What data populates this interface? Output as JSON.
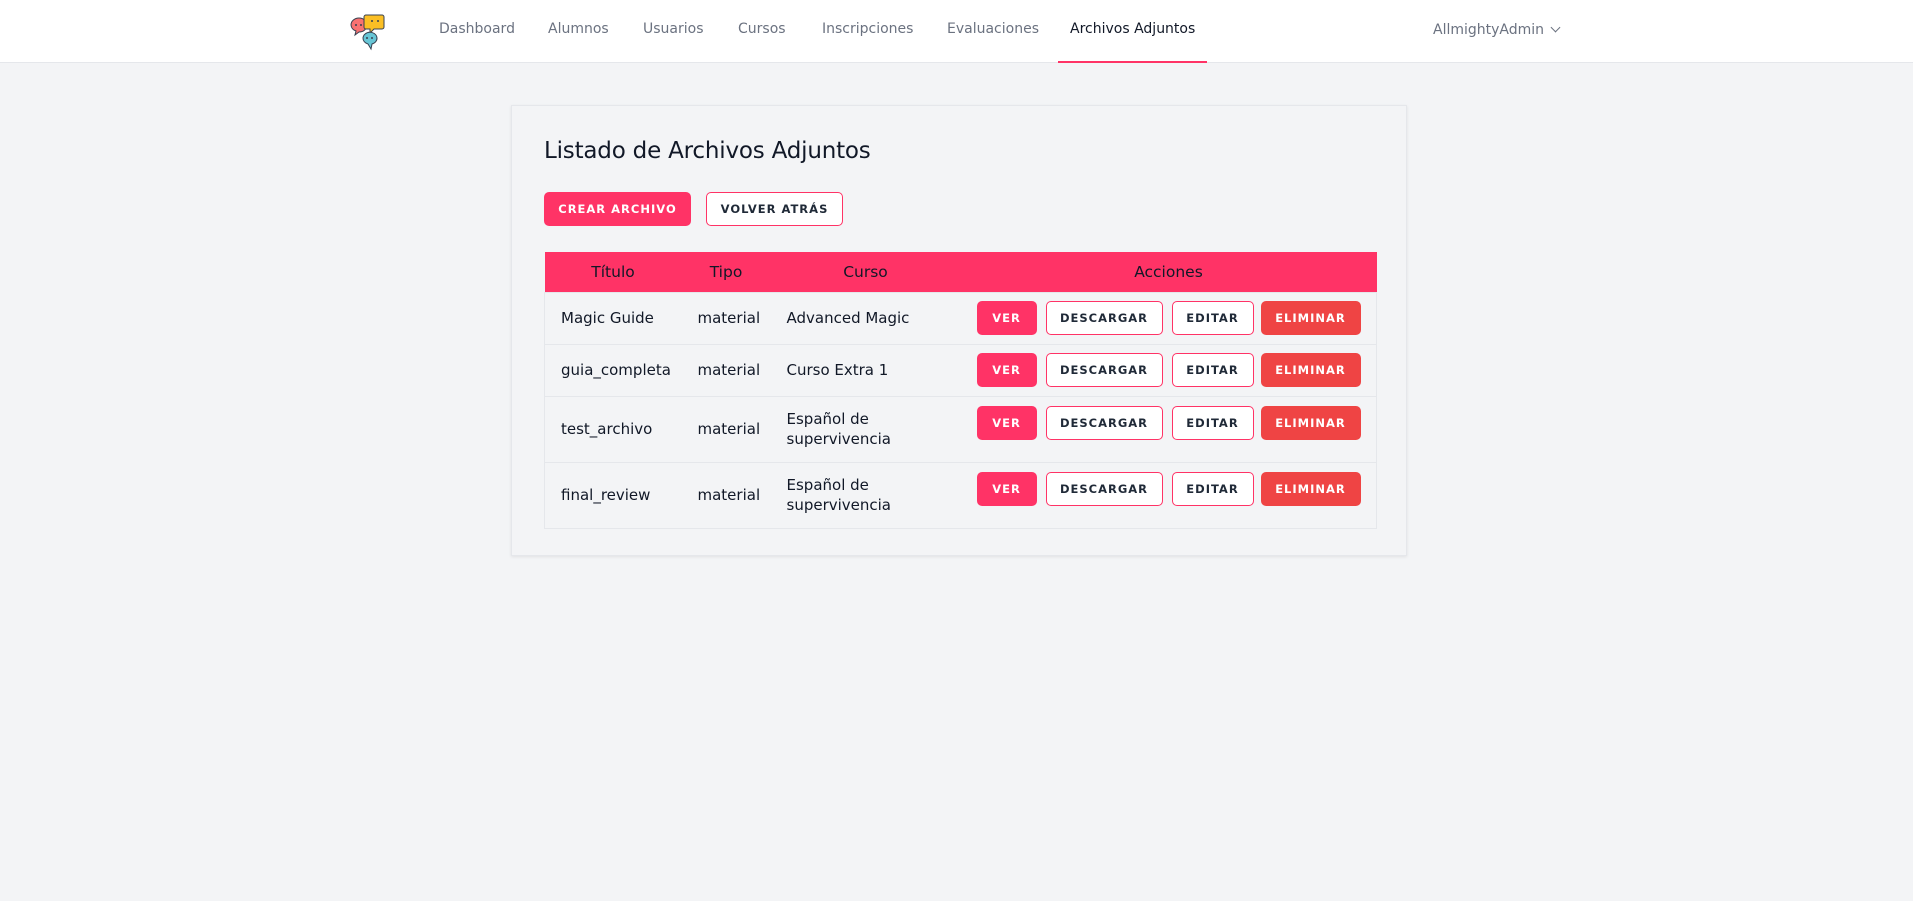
{
  "nav": {
    "items": [
      {
        "label": "Dashboard",
        "active": false
      },
      {
        "label": "Alumnos",
        "active": false
      },
      {
        "label": "Usuarios",
        "active": false
      },
      {
        "label": "Cursos",
        "active": false
      },
      {
        "label": "Inscripciones",
        "active": false
      },
      {
        "label": "Evaluaciones",
        "active": false
      },
      {
        "label": "Archivos Adjuntos",
        "active": true
      }
    ],
    "user": "AllmightyAdmin"
  },
  "page": {
    "title": "Listado de Archivos Adjuntos",
    "create_label": "CREAR ARCHIVO",
    "back_label": "VOLVER ATRÁS"
  },
  "table": {
    "headers": [
      "Título",
      "Tipo",
      "Curso",
      "Acciones"
    ],
    "action_labels": {
      "view": "VER",
      "download": "DESCARGAR",
      "edit": "EDITAR",
      "delete": "ELIMINAR"
    },
    "rows": [
      {
        "titulo": "Magic Guide",
        "tipo": "material",
        "curso": "Advanced Magic"
      },
      {
        "titulo": "guia_completa",
        "tipo": "material",
        "curso": "Curso Extra 1"
      },
      {
        "titulo": "test_archivo",
        "tipo": "material",
        "curso": "Español de supervivencia"
      },
      {
        "titulo": "final_review",
        "tipo": "material",
        "curso": "Español de supervivencia"
      }
    ]
  },
  "colors": {
    "accent": "#ff3366",
    "danger": "#ef4444",
    "background": "#f3f4f6"
  }
}
